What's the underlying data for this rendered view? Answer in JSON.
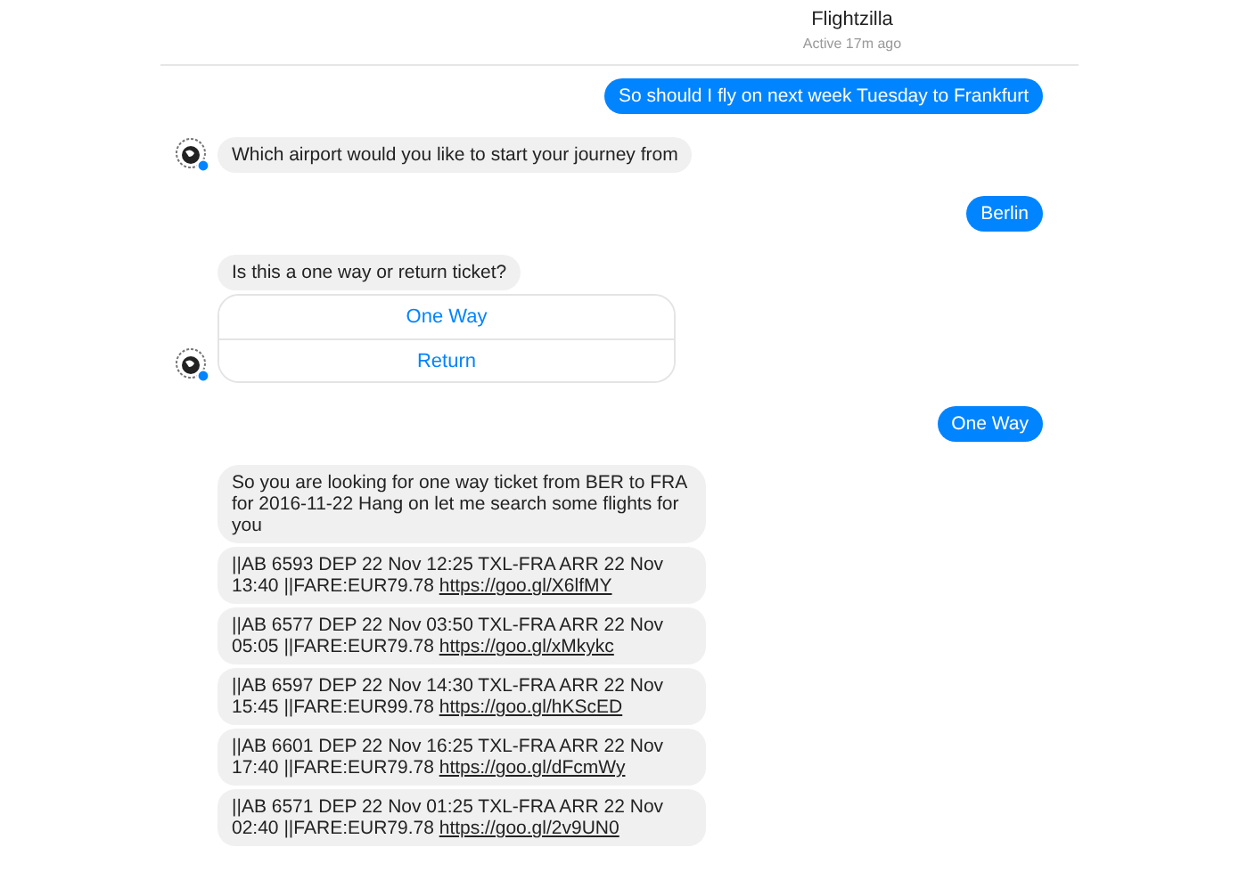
{
  "header": {
    "title": "Flightzilla",
    "status": "Active 17m ago"
  },
  "messages": [
    {
      "kind": "out",
      "text": "So should I fly on next week Tuesday to Frankfurt"
    },
    {
      "kind": "in",
      "text": "Which airport would you like to start your journey from",
      "avatar": true
    },
    {
      "kind": "out",
      "text": "Berlin"
    },
    {
      "kind": "in",
      "text": "Is this a one way or return ticket?",
      "avatar": false
    },
    {
      "kind": "quick_replies",
      "options": [
        "One Way",
        "Return"
      ],
      "avatar": true
    },
    {
      "kind": "out",
      "text": "One Way"
    },
    {
      "kind": "in",
      "text": "So you are looking for one way ticket from BER to FRA for 2016-11-22 Hang on let me search some flights for you",
      "avatar": false
    },
    {
      "kind": "flight",
      "text": "||AB  6593 DEP 22 Nov 12:25 TXL-FRA ARR 22 Nov 13:40 ||FARE:EUR79.78",
      "link": "https://goo.gl/X6lfMY"
    },
    {
      "kind": "flight",
      "text": "||AB  6577 DEP 22 Nov 03:50 TXL-FRA ARR 22 Nov 05:05 ||FARE:EUR79.78",
      "link": "https://goo.gl/xMkykc"
    },
    {
      "kind": "flight",
      "text": "||AB  6597 DEP 22 Nov 14:30 TXL-FRA ARR 22 Nov 15:45 ||FARE:EUR99.78",
      "link": "https://goo.gl/hKScED"
    },
    {
      "kind": "flight",
      "text": "||AB  6601 DEP 22 Nov 16:25 TXL-FRA ARR 22 Nov 17:40 ||FARE:EUR79.78",
      "link": "https://goo.gl/dFcmWy"
    },
    {
      "kind": "flight",
      "text": "||AB  6571 DEP 22 Nov 01:25 TXL-FRA ARR 22 Nov 02:40 ||FARE:EUR79.78",
      "link": "https://goo.gl/2v9UN0"
    }
  ]
}
